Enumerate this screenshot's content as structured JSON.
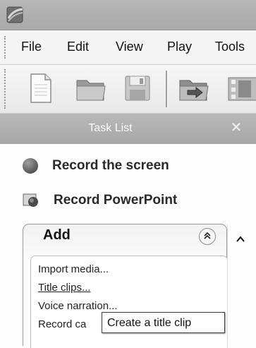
{
  "menu": {
    "items": [
      "File",
      "Edit",
      "View",
      "Play",
      "Tools"
    ]
  },
  "toolbar": {
    "buttons": [
      "new-document-icon",
      "open-folder-icon",
      "save-disk-icon",
      "import-folder-icon",
      "film-icon"
    ]
  },
  "task_list": {
    "title": "Task List",
    "close_glyph": "✕",
    "record_screen_label": "Record the screen",
    "record_powerpoint_label": "Record PowerPoint"
  },
  "add_panel": {
    "title": "Add",
    "collapse_glyph": "»",
    "items": [
      "Import media...",
      "Title clips...",
      "Voice narration...",
      "Record ca"
    ]
  },
  "scrollbar": {
    "up_glyph": "^"
  },
  "tooltip": {
    "text": "Create a title clip"
  }
}
